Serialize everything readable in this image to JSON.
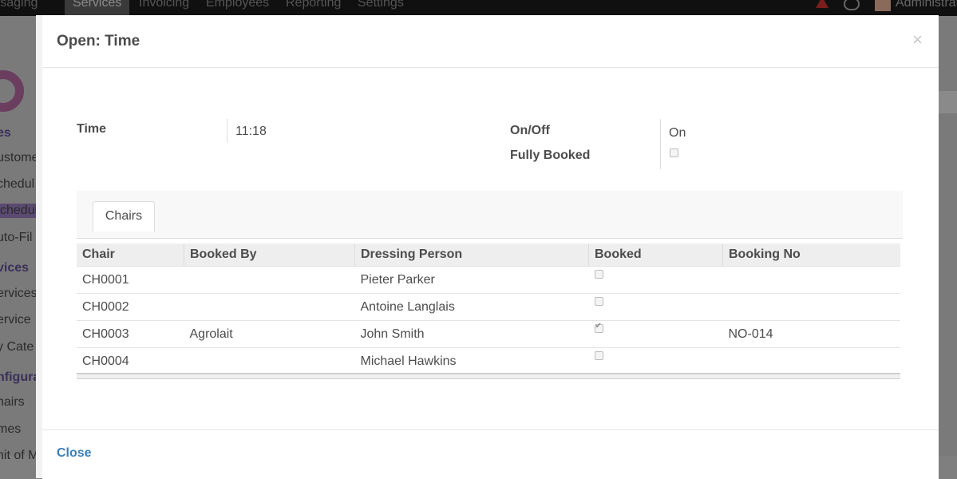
{
  "background": {
    "menu": [
      "Messaging",
      "Services",
      "Invoicing",
      "Employees",
      "Reporting",
      "Settings"
    ],
    "active_menu": "Services",
    "user": "Administrator",
    "sidebar": [
      {
        "label": "es",
        "kind": "head"
      },
      {
        "label": "ustome",
        "kind": "item"
      },
      {
        "label": "chedul",
        "kind": "item"
      },
      {
        "label": "chedul",
        "kind": "selected"
      },
      {
        "label": "uto-Fil",
        "kind": "item"
      },
      {
        "label": "vices",
        "kind": "head"
      },
      {
        "label": "ervices",
        "kind": "item"
      },
      {
        "label": "ervice",
        "kind": "item"
      },
      {
        "label": "y Cate",
        "kind": "item"
      },
      {
        "label": "nfigura",
        "kind": "head"
      },
      {
        "label": "hairs",
        "kind": "item"
      },
      {
        "label": "mes",
        "kind": "item"
      },
      {
        "label": "nit of M",
        "kind": "item"
      }
    ]
  },
  "modal": {
    "title": "Open: Time",
    "close_symbol": "×",
    "fields": {
      "time_label": "Time",
      "time_value": "11:18",
      "onoff_label": "On/Off",
      "onoff_value": "On",
      "fully_booked_label": "Fully Booked",
      "fully_booked": false
    },
    "tabs": [
      "Chairs"
    ],
    "table": {
      "columns": [
        "Chair",
        "Booked By",
        "Dressing Person",
        "Booked",
        "Booking No"
      ],
      "rows": [
        {
          "chair": "CH0001",
          "booked_by": "",
          "dressing_person": "Pieter Parker",
          "booked": false,
          "booking_no": ""
        },
        {
          "chair": "CH0002",
          "booked_by": "",
          "dressing_person": "Antoine Langlais",
          "booked": false,
          "booking_no": ""
        },
        {
          "chair": "CH0003",
          "booked_by": "Agrolait",
          "dressing_person": "John Smith",
          "booked": true,
          "booking_no": "NO-014"
        },
        {
          "chair": "CH0004",
          "booked_by": "",
          "dressing_person": "Michael Hawkins",
          "booked": false,
          "booking_no": ""
        }
      ]
    },
    "footer": {
      "close_label": "Close"
    }
  },
  "colors": {
    "link": "#3c7fb8",
    "logo": "#6b3d5f",
    "topbar": "#101010"
  }
}
